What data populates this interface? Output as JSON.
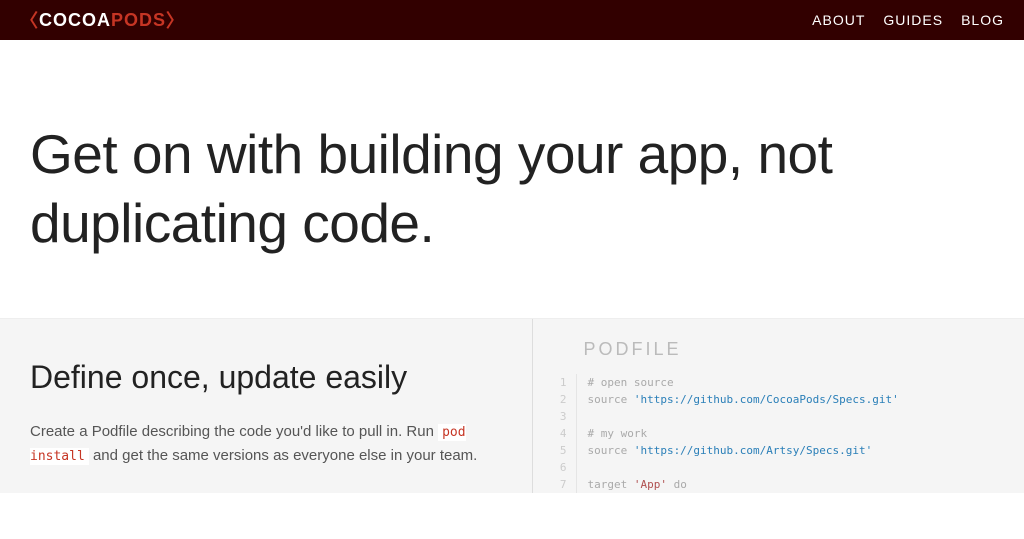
{
  "logo": {
    "open": "〈",
    "cocoa": "COCOA",
    "pods": "PODS",
    "close": "〉"
  },
  "nav": {
    "about": "ABOUT",
    "guides": "GUIDES",
    "blog": "BLOG"
  },
  "hero": {
    "title": "Get on with building your app, not duplicating code."
  },
  "define": {
    "title": "Define once, update easily",
    "p1": "Create a Podfile describing the code you'd like to pull in. Run ",
    "code": "pod install",
    "p2": " and get the same versions as everyone else in your team."
  },
  "podfile": {
    "title": "PODFILE",
    "lines": [
      {
        "n": "1",
        "type": "comment",
        "text": "# open source"
      },
      {
        "n": "2",
        "type": "source",
        "kw": "source ",
        "str": "'https://github.com/CocoaPods/Specs.git'"
      },
      {
        "n": "3",
        "type": "blank",
        "text": ""
      },
      {
        "n": "4",
        "type": "comment",
        "text": "# my work"
      },
      {
        "n": "5",
        "type": "source",
        "kw": "source ",
        "str": "'https://github.com/Artsy/Specs.git'"
      },
      {
        "n": "6",
        "type": "blank",
        "text": ""
      },
      {
        "n": "7",
        "type": "target",
        "kw": "target ",
        "str": "'App'",
        "after": " do"
      }
    ]
  }
}
